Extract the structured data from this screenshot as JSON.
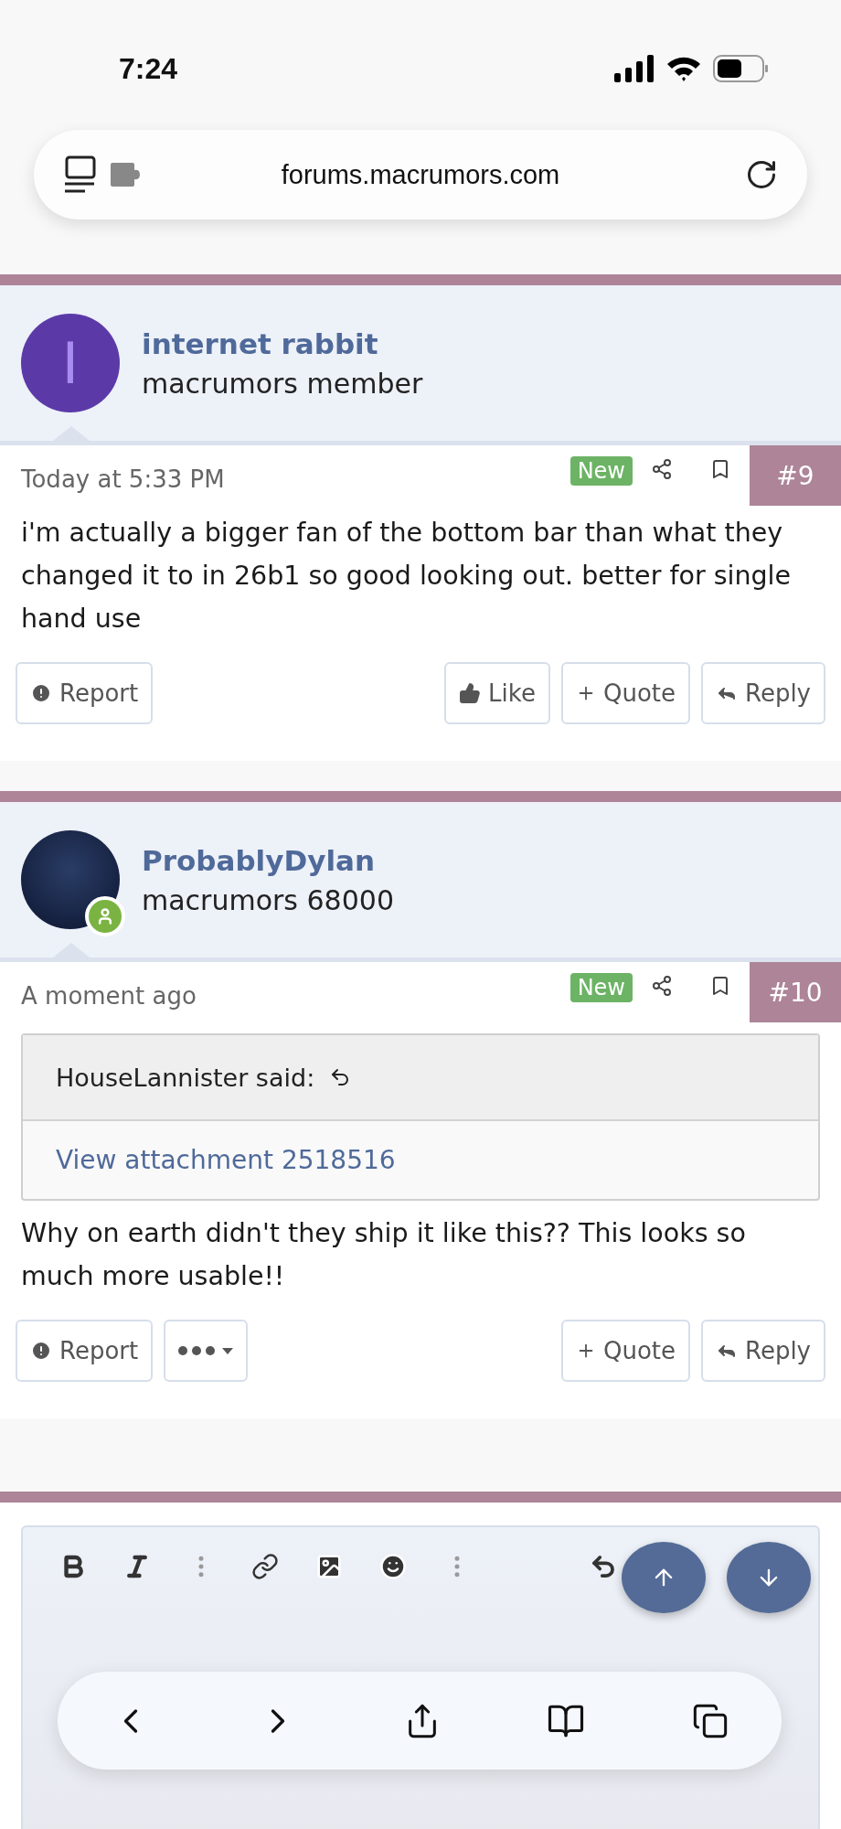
{
  "status_bar": {
    "time": "7:24"
  },
  "address_bar": {
    "url": "forums.macrumors.com"
  },
  "posts": [
    {
      "author": "internet rabbit",
      "role": "macrumors member",
      "avatar": {
        "kind": "letter",
        "letter": "I",
        "color": "#5b3aa8"
      },
      "online": false,
      "time": "Today at 5:33 PM",
      "badge": "New",
      "number": "#9",
      "body": "i'm actually a bigger fan of the bottom bar than what they changed it to in 26b1 so good looking out. better for single hand use",
      "actions": [
        {
          "kind": "report",
          "label": "Report"
        },
        {
          "kind": "like",
          "label": "Like"
        },
        {
          "kind": "quote",
          "label": "Quote"
        },
        {
          "kind": "reply",
          "label": "Reply"
        }
      ]
    },
    {
      "author": "ProbablyDylan",
      "role": "macrumors 68000",
      "avatar": {
        "kind": "photo"
      },
      "online": true,
      "time": "A moment ago",
      "badge": "New",
      "number": "#10",
      "quote": {
        "header": "HouseLannister said:",
        "link": "View attachment 2518516"
      },
      "body": "Why on earth didn't they ship it like this?? This looks so much more usable!!",
      "actions": [
        {
          "kind": "report",
          "label": "Report"
        },
        {
          "kind": "more"
        },
        {
          "kind": "quote",
          "label": "Quote"
        },
        {
          "kind": "reply",
          "label": "Reply"
        }
      ]
    }
  ],
  "editor_toolbar": [
    {
      "kind": "bold"
    },
    {
      "kind": "italic"
    },
    {
      "kind": "more"
    },
    {
      "kind": "link"
    },
    {
      "kind": "image"
    },
    {
      "kind": "emoji"
    },
    {
      "kind": "more"
    },
    {
      "kind": "undo"
    }
  ]
}
